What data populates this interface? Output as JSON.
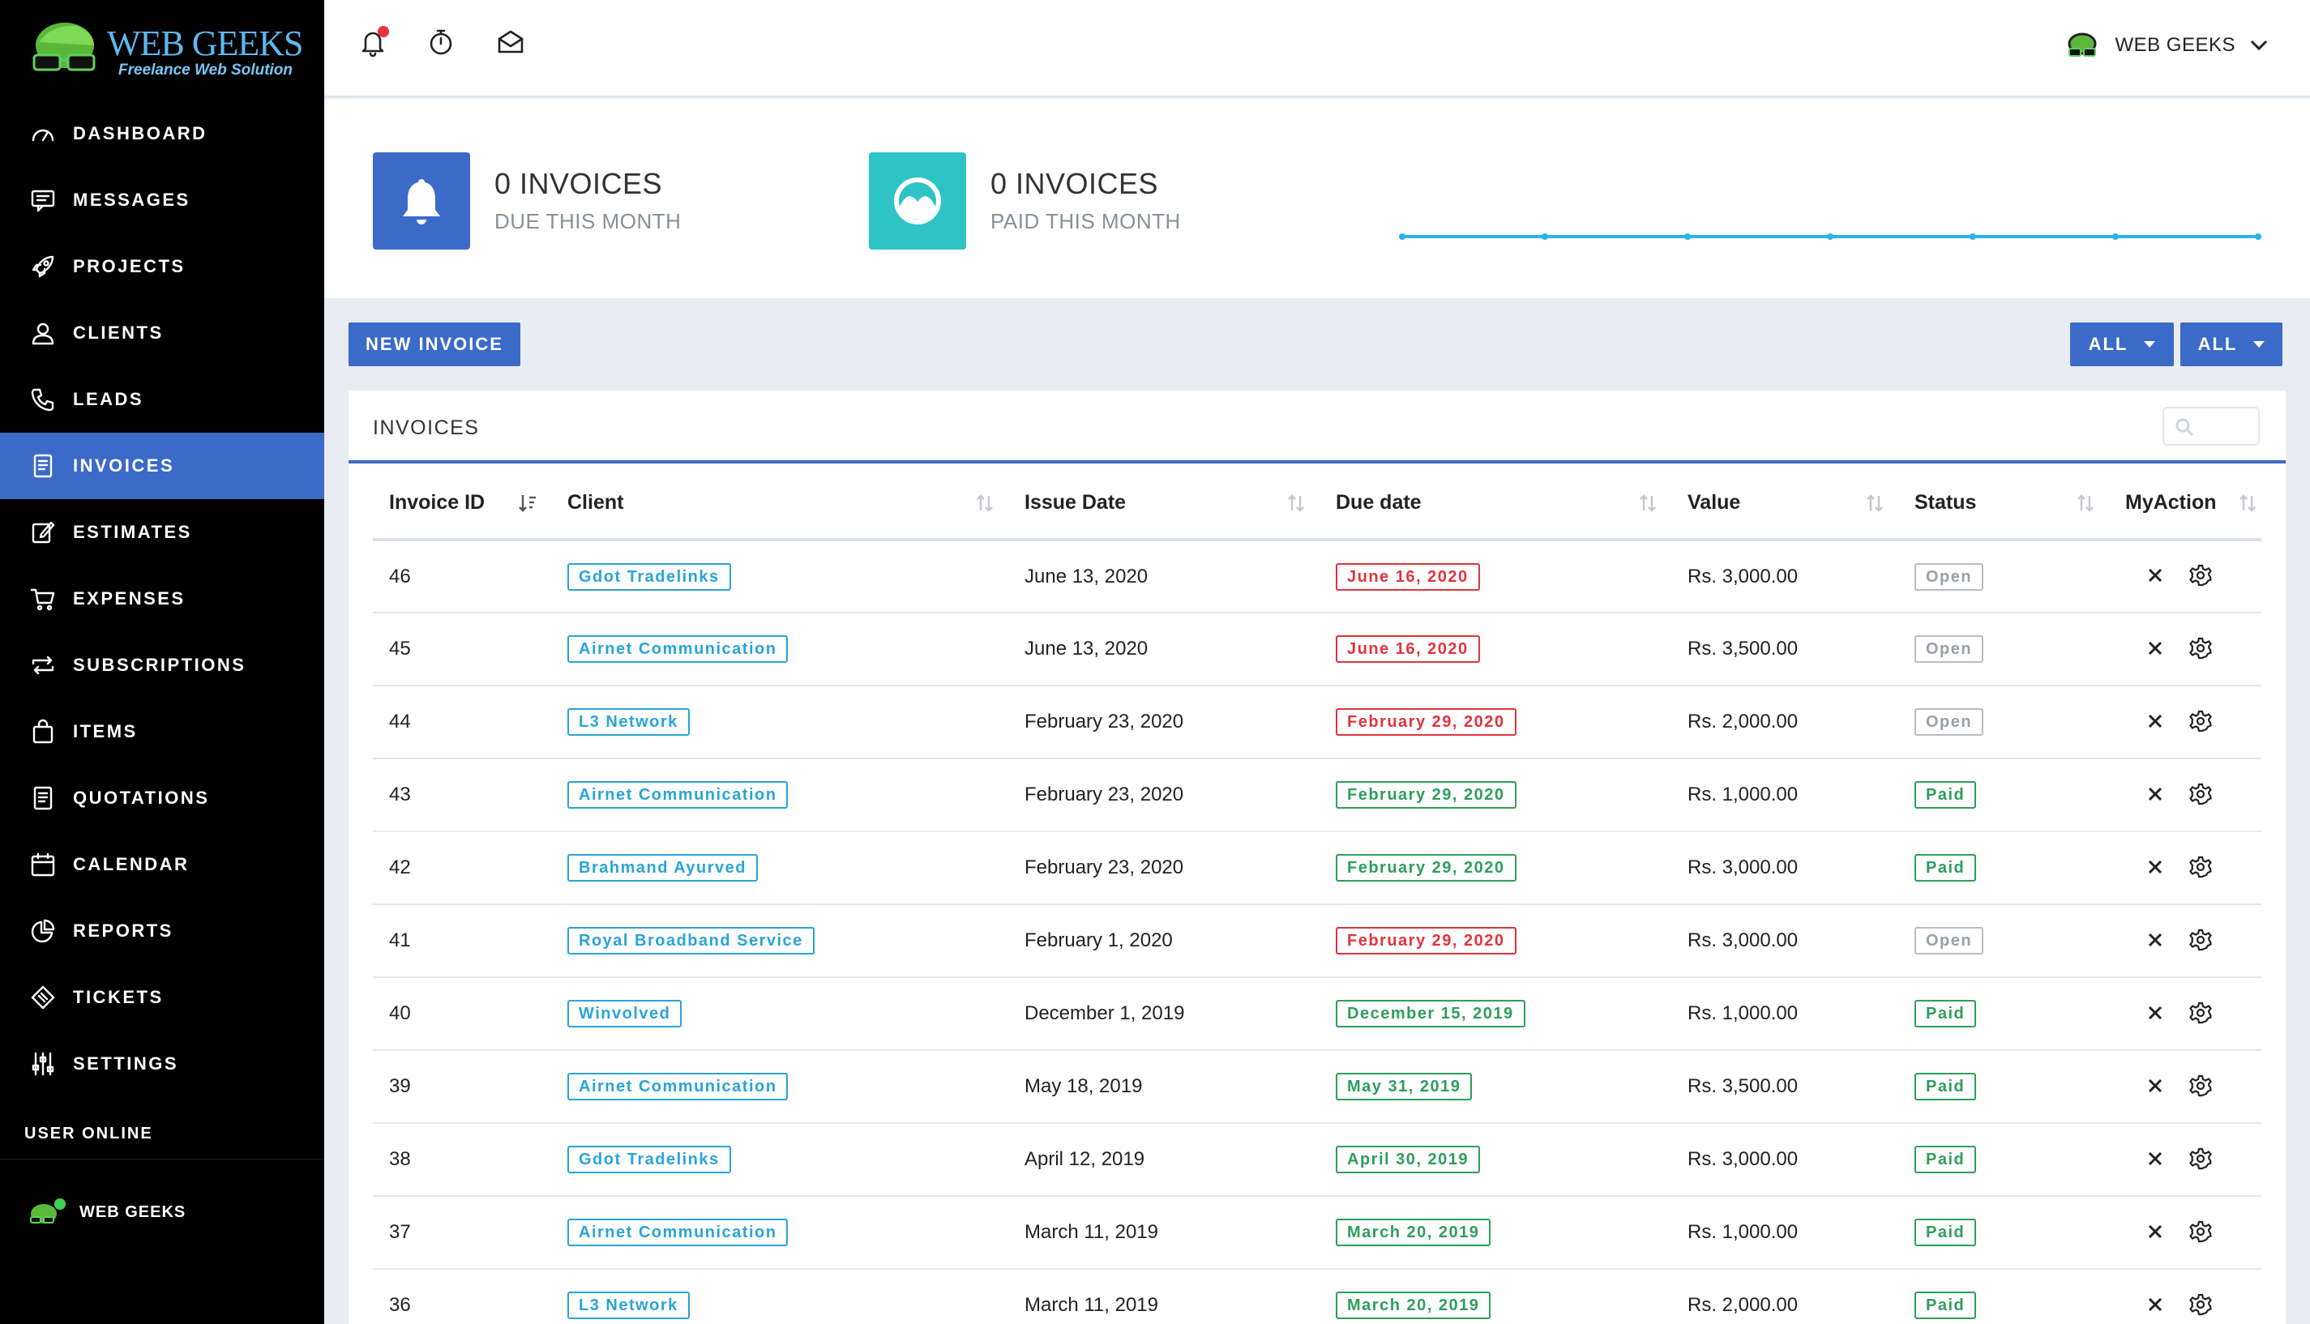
{
  "brand": {
    "title": "WEB GEEKS",
    "subtitle": "Freelance Web Solution"
  },
  "sidebar": {
    "items": [
      {
        "label": "DASHBOARD",
        "icon": "gauge-icon"
      },
      {
        "label": "MESSAGES",
        "icon": "message-icon"
      },
      {
        "label": "PROJECTS",
        "icon": "rocket-icon"
      },
      {
        "label": "CLIENTS",
        "icon": "user-icon"
      },
      {
        "label": "LEADS",
        "icon": "phone-icon"
      },
      {
        "label": "INVOICES",
        "icon": "document-icon",
        "active": true
      },
      {
        "label": "ESTIMATES",
        "icon": "edit-icon"
      },
      {
        "label": "EXPENSES",
        "icon": "cart-icon"
      },
      {
        "label": "SUBSCRIPTIONS",
        "icon": "repeat-icon"
      },
      {
        "label": "ITEMS",
        "icon": "bag-icon"
      },
      {
        "label": "QUOTATIONS",
        "icon": "document-icon"
      },
      {
        "label": "CALENDAR",
        "icon": "calendar-icon"
      },
      {
        "label": "REPORTS",
        "icon": "chart-icon"
      },
      {
        "label": "TICKETS",
        "icon": "ticket-icon"
      },
      {
        "label": "SETTINGS",
        "icon": "sliders-icon"
      }
    ],
    "online_heading": "USER ONLINE",
    "online_user": "WEB GEEKS"
  },
  "topbar": {
    "user_name": "WEB GEEKS"
  },
  "stats": {
    "due": {
      "count": "0 INVOICES",
      "label": "DUE THIS MONTH"
    },
    "paid": {
      "count": "0 INVOICES",
      "label": "PAID THIS MONTH"
    }
  },
  "actions": {
    "new_invoice": "NEW INVOICE",
    "filter1": "ALL",
    "filter2": "ALL"
  },
  "invoices": {
    "title": "INVOICES",
    "columns": [
      "Invoice ID",
      "Client",
      "Issue Date",
      "Due date",
      "Value",
      "Status",
      "MyAction"
    ],
    "rows": [
      {
        "id": "46",
        "client": "Gdot Tradelinks",
        "issue": "June 13, 2020",
        "due": "June 16, 2020",
        "due_state": "overdue",
        "value": "Rs. 3,000.00",
        "status": "Open"
      },
      {
        "id": "45",
        "client": "Airnet Communication",
        "issue": "June 13, 2020",
        "due": "June 16, 2020",
        "due_state": "overdue",
        "value": "Rs. 3,500.00",
        "status": "Open"
      },
      {
        "id": "44",
        "client": "L3 Network",
        "issue": "February 23, 2020",
        "due": "February 29, 2020",
        "due_state": "overdue",
        "value": "Rs. 2,000.00",
        "status": "Open"
      },
      {
        "id": "43",
        "client": "Airnet Communication",
        "issue": "February 23, 2020",
        "due": "February 29, 2020",
        "due_state": "ok",
        "value": "Rs. 1,000.00",
        "status": "Paid"
      },
      {
        "id": "42",
        "client": "Brahmand Ayurved",
        "issue": "February 23, 2020",
        "due": "February 29, 2020",
        "due_state": "ok",
        "value": "Rs. 3,000.00",
        "status": "Paid"
      },
      {
        "id": "41",
        "client": "Royal Broadband Service",
        "issue": "February 1, 2020",
        "due": "February 29, 2020",
        "due_state": "overdue",
        "value": "Rs. 3,000.00",
        "status": "Open"
      },
      {
        "id": "40",
        "client": "Winvolved",
        "issue": "December 1, 2019",
        "due": "December 15, 2019",
        "due_state": "ok",
        "value": "Rs. 1,000.00",
        "status": "Paid"
      },
      {
        "id": "39",
        "client": "Airnet Communication",
        "issue": "May 18, 2019",
        "due": "May 31, 2019",
        "due_state": "ok",
        "value": "Rs. 3,500.00",
        "status": "Paid"
      },
      {
        "id": "38",
        "client": "Gdot Tradelinks",
        "issue": "April 12, 2019",
        "due": "April 30, 2019",
        "due_state": "ok",
        "value": "Rs. 3,000.00",
        "status": "Paid"
      },
      {
        "id": "37",
        "client": "Airnet Communication",
        "issue": "March 11, 2019",
        "due": "March 20, 2019",
        "due_state": "ok",
        "value": "Rs. 1,000.00",
        "status": "Paid"
      },
      {
        "id": "36",
        "client": "L3 Network",
        "issue": "March 11, 2019",
        "due": "March 20, 2019",
        "due_state": "ok",
        "value": "Rs. 2,000.00",
        "status": "Paid"
      }
    ]
  },
  "colors": {
    "accent": "#3c6ac8",
    "teal": "#2ec4c6",
    "sparkline": "#29b3e6",
    "overdue": "#e0343e",
    "paid": "#2e9e5b",
    "client": "#2aa4d8"
  }
}
